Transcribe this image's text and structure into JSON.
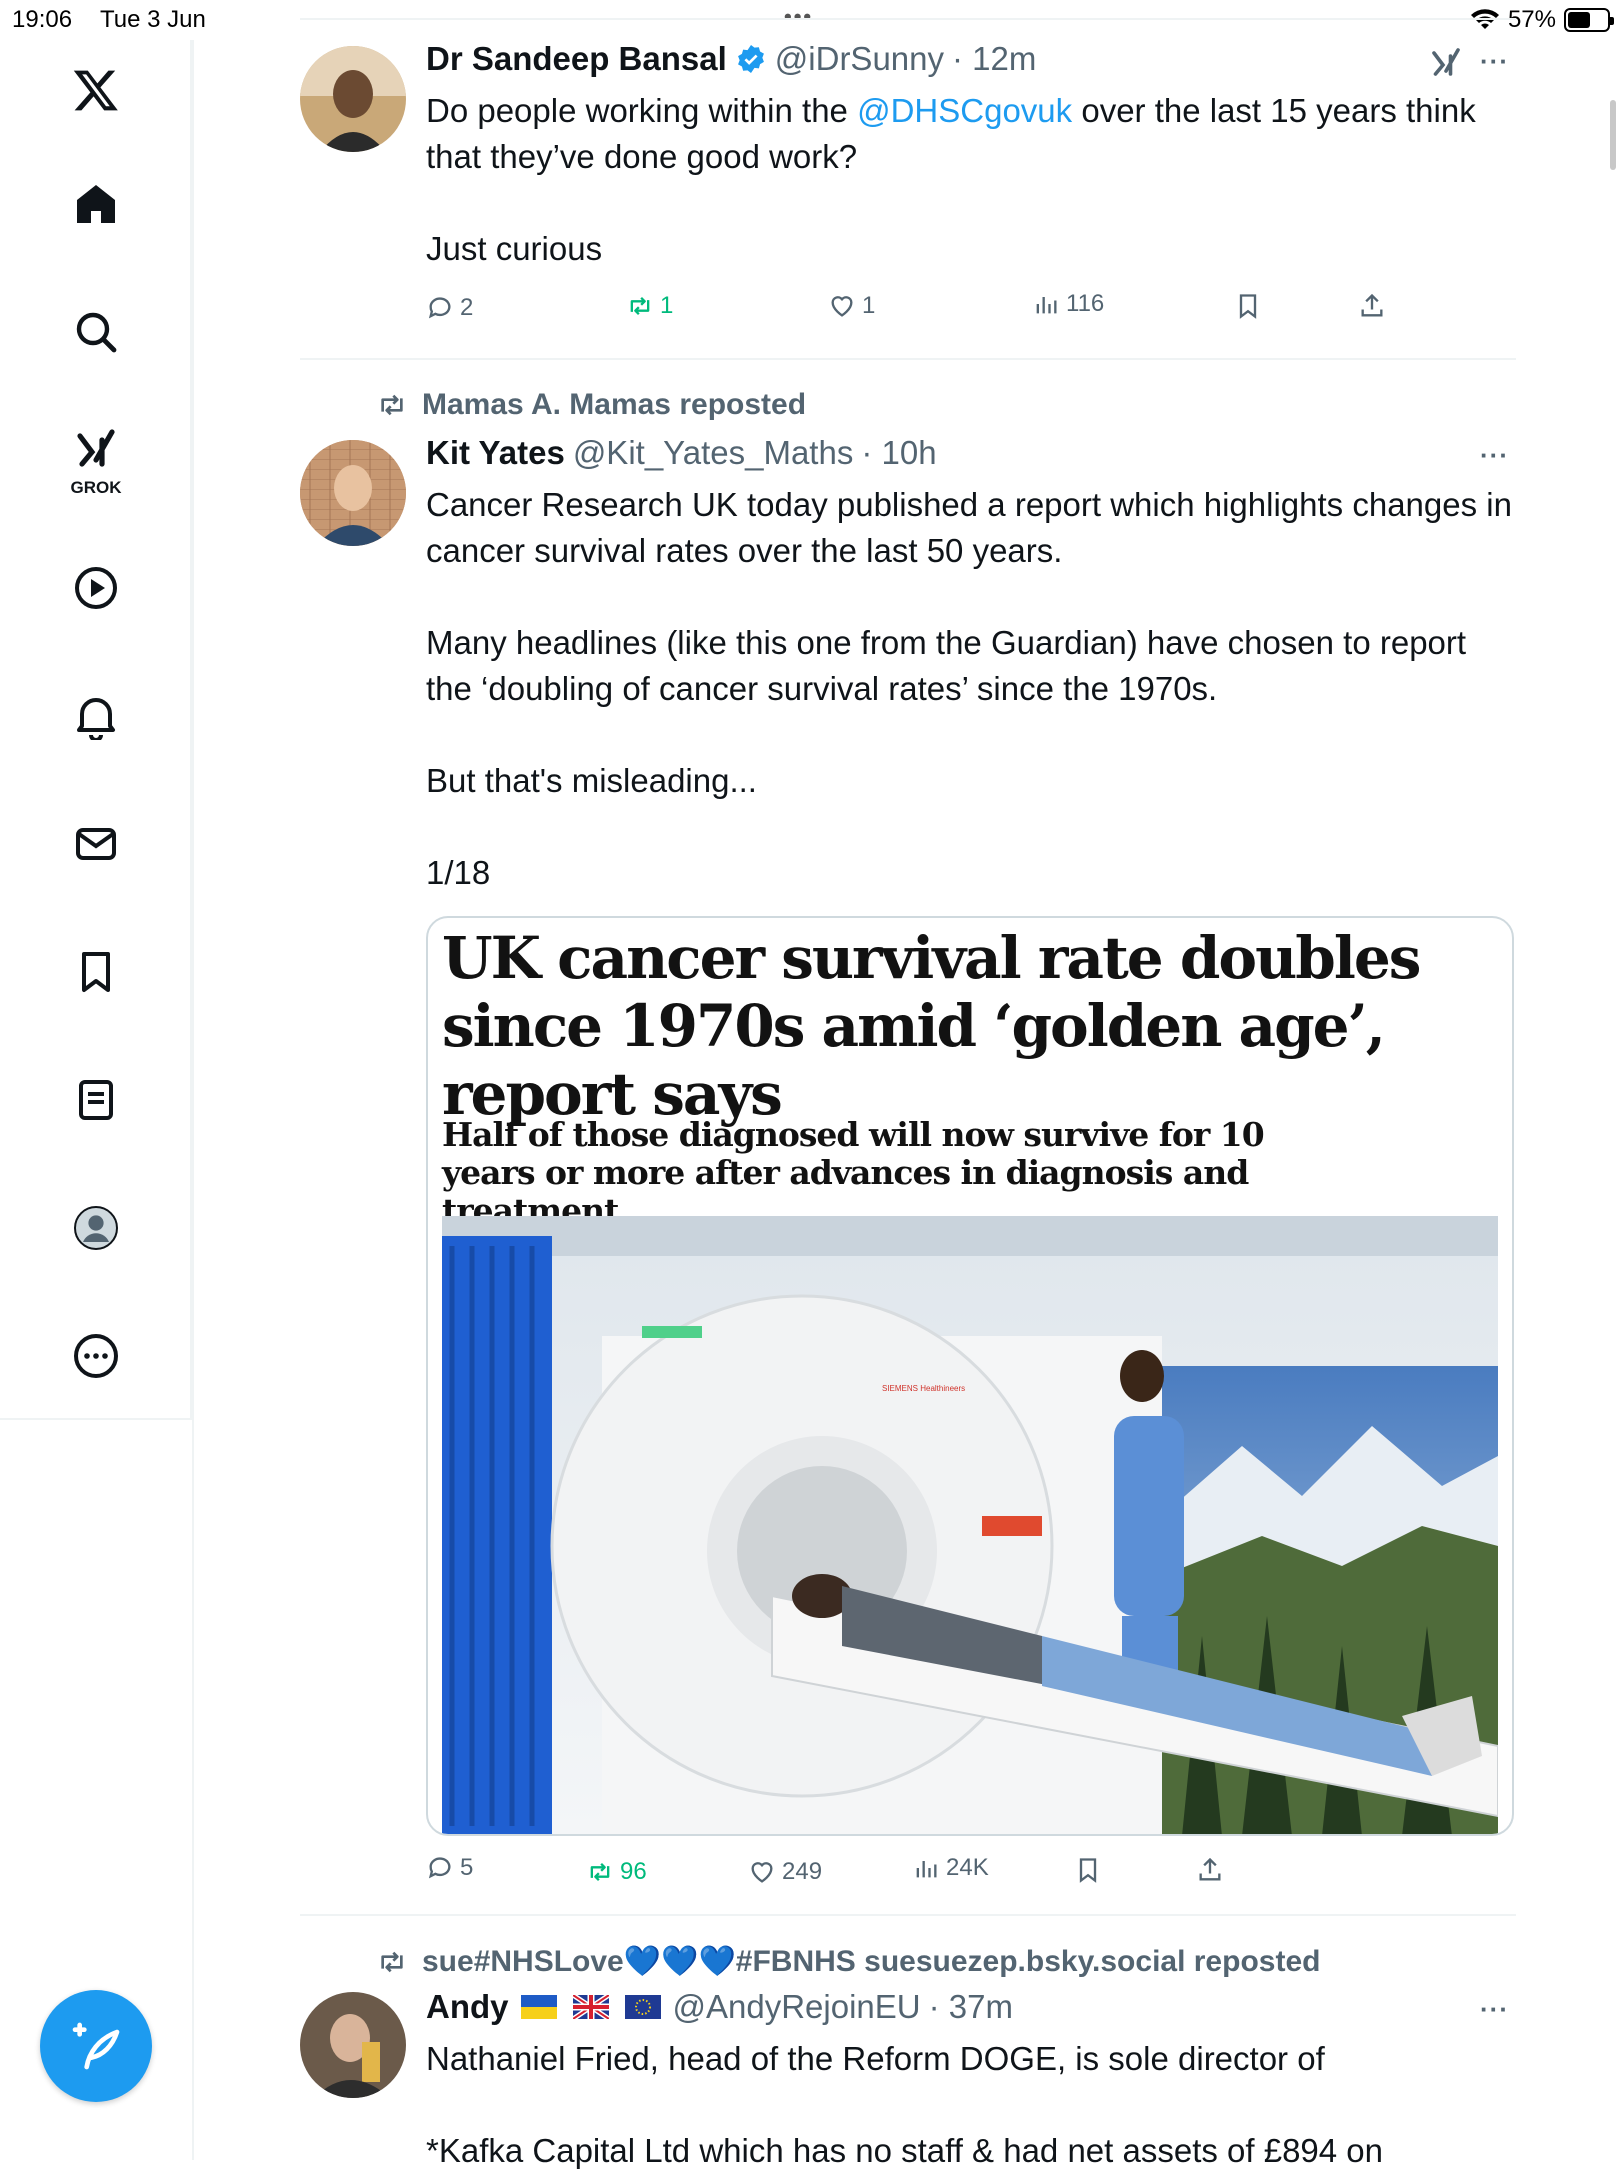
{
  "status_bar": {
    "time": "19:06",
    "date": "Tue 3 Jun",
    "battery": "57%",
    "battery_level": 0.57
  },
  "sidebar": {
    "items": [
      {
        "icon": "x-logo-icon"
      },
      {
        "icon": "home-icon"
      },
      {
        "icon": "search-icon"
      },
      {
        "icon": "grok-icon",
        "label": "GROK"
      },
      {
        "icon": "video-icon"
      },
      {
        "icon": "notifications-icon"
      },
      {
        "icon": "messages-icon"
      },
      {
        "icon": "bookmarks-icon"
      },
      {
        "icon": "lists-icon"
      },
      {
        "icon": "profile-icon"
      },
      {
        "icon": "more-icon"
      }
    ],
    "compose_icon": "compose-icon"
  },
  "tweets": [
    {
      "name": "Dr Sandeep Bansal",
      "verified": true,
      "handle": "@iDrSunny",
      "time": "· 12m",
      "text_before": "Do people working within the ",
      "mention": "@DHSCgovuk",
      "text_after": " over the last 15 years think that they’ve done good work?\n\nJust curious",
      "replies": "2",
      "reposts": "1",
      "likes": "1",
      "views": "116"
    },
    {
      "reposted_by": "Mamas A. Mamas reposted",
      "name": "Kit Yates",
      "handle": "@Kit_Yates_Maths",
      "time": "· 10h",
      "text": "Cancer Research UK today published a report which highlights changes in cancer survival rates over the last 50 years.\n\nMany headlines (like this one from the Guardian) have chosen to report the ‘doubling of cancer survival rates’ since the 1970s.\n\nBut that's misleading...\n\n1/18",
      "card": {
        "headline": "UK cancer survival rate doubles since 1970s amid ‘golden age’, report says",
        "subheadline": "Half of those diagnosed will now survive for 10 years or more after advances in diagnosis and treatment",
        "scanner_brand": "SIEMENS Healthineers"
      },
      "replies": "5",
      "reposts": "96",
      "likes": "249",
      "views": "24K"
    },
    {
      "reposted_by": "sue#NHSLove💙💙💙#FBNHS suesuezep.bsky.social reposted",
      "name": "Andy",
      "handle": "@AndyRejoinEU",
      "time": "· 37m",
      "text": "Nathaniel Fried, head of the Reform DOGE, is sole director of\n\n*Kafka Capital Ltd which has no staff & had net assets of £894 on"
    }
  ],
  "colors": {
    "accent": "#1d9bf0",
    "repost_green": "#00ba7c",
    "secondary_text": "#536471",
    "border": "#eff3f4"
  }
}
